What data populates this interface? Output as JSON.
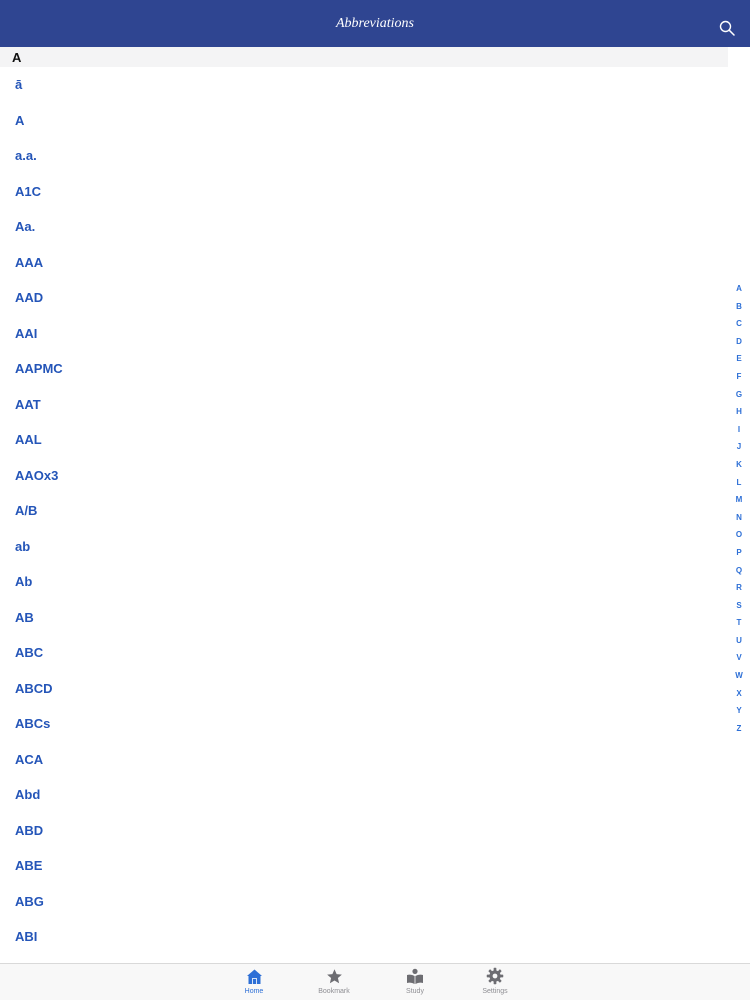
{
  "header": {
    "title": "Abbreviations",
    "search_icon": "search-icon"
  },
  "section": {
    "letter": "A"
  },
  "list": {
    "items": [
      "ā",
      "A",
      "a.a.",
      "A1C",
      "Aa.",
      "AAA",
      "AAD",
      "AAI",
      "AAPMC",
      "AAT",
      "AAL",
      "AAOx3",
      "A/B",
      "ab",
      "Ab",
      "AB",
      "ABC",
      "ABCD",
      "ABCs",
      "ACA",
      "Abd",
      "ABD",
      "ABE",
      "ABG",
      "ABI"
    ]
  },
  "index": {
    "letters": [
      "A",
      "B",
      "C",
      "D",
      "E",
      "F",
      "G",
      "H",
      "I",
      "J",
      "K",
      "L",
      "M",
      "N",
      "O",
      "P",
      "Q",
      "R",
      "S",
      "T",
      "U",
      "V",
      "W",
      "X",
      "Y",
      "Z"
    ]
  },
  "tabs": [
    {
      "label": "Home",
      "icon": "home-icon",
      "active": true
    },
    {
      "label": "Bookmark",
      "icon": "star-icon",
      "active": false
    },
    {
      "label": "Study",
      "icon": "book-icon",
      "active": false
    },
    {
      "label": "Settings",
      "icon": "gear-icon",
      "active": false
    }
  ],
  "colors": {
    "navbar": "#2f4591",
    "link": "#2455b8",
    "accent": "#2d6fd6",
    "inactive": "#8e8e93"
  }
}
